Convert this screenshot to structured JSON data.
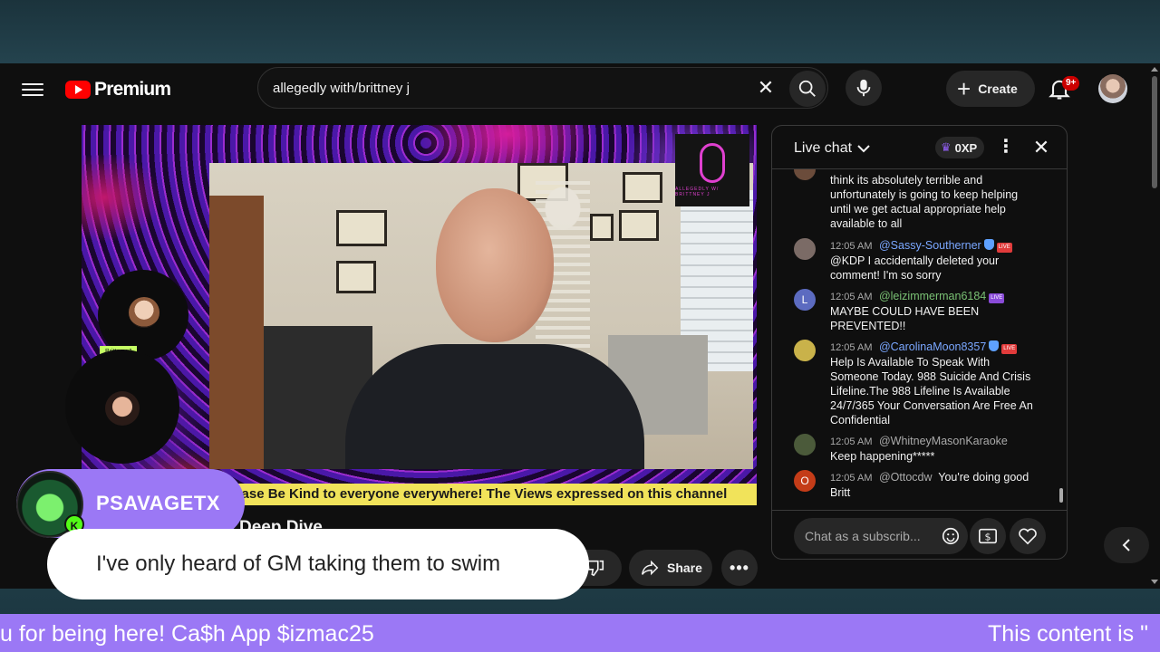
{
  "masthead": {
    "brand": "Premium",
    "search": {
      "value": "allegedly with/brittney j",
      "placeholder": "Search"
    },
    "create_label": "Create",
    "notification_badge": "9+"
  },
  "video": {
    "logo_label": "ALLEGEDLY W/ BRITTNEY J",
    "ticker": "lease Be Kind to everyone everywhere! The Views expressed on this channel",
    "guest_label": "Brittney J",
    "title_fragment": "Deep Dive"
  },
  "actions": {
    "share_label": "Share"
  },
  "chat": {
    "title": "Live chat",
    "xp": "0XP",
    "input_placeholder": "Chat as a subscrib...",
    "messages": [
      {
        "time": "",
        "author": "",
        "text": "think its absolutely terrible and unfortunately is going to keep helping until we get actual appropriate help available to all",
        "avatar_color": "#6b4c3b"
      },
      {
        "time": "12:05 AM",
        "author": "@Sassy-Southerner",
        "text": "@KDP I accidentally deleted your comment! I'm so sorry",
        "avatar_color": "#7b6b66"
      },
      {
        "time": "12:05 AM",
        "author": "@leizimmerman6184",
        "text": "MAYBE COULD HAVE BEEN PREVENTED!!",
        "avatar_color": "#5c6bc0",
        "initial": "L"
      },
      {
        "time": "12:05 AM",
        "author": "@CarolinaMoon8357",
        "text": "Help Is Available To Speak With Someone Today. 988 Suicide And Crisis Lifeline.The 988 Lifeline Is Available 24/7/365 Your Conversation Are Free An Confidential",
        "avatar_color": "#c9b24a"
      },
      {
        "time": "12:05 AM",
        "author": "@WhitneyMasonKaraoke",
        "text": "Keep happening*****",
        "avatar_color": "#4b5a3a"
      },
      {
        "time": "12:05 AM",
        "author": "@Ottocdw",
        "text": "You're doing good Britt",
        "avatar_color": "#c43c18",
        "initial": "O"
      }
    ]
  },
  "overlay": {
    "alert_name": "PSAVAGETX",
    "alert_badge": "K",
    "alert_message": "I've only heard of GM taking them to swim",
    "bottom_left": "u for being here! Ca$h App $izmac25",
    "bottom_right": "This content is \""
  }
}
